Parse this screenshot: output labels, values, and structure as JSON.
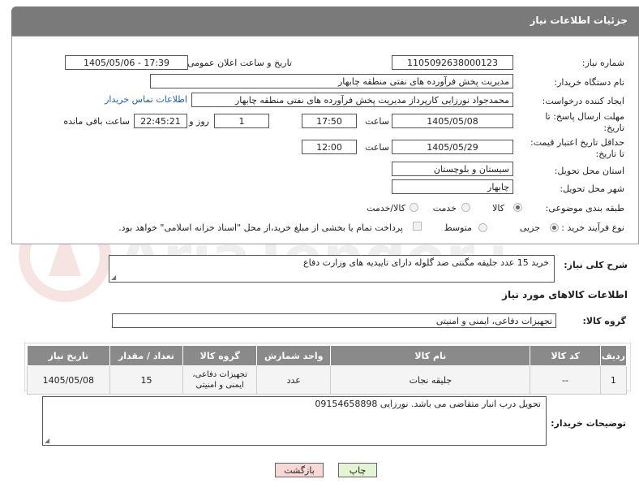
{
  "header": {
    "title": "جزئیات اطلاعات نیاز"
  },
  "form": {
    "need_number": {
      "label": "شماره نیاز:",
      "value": "1105092638000123"
    },
    "announce_datetime": {
      "label": "تاریخ و ساعت اعلان عمومی:",
      "value": "1405/05/06 - 17:39"
    },
    "buyer_org": {
      "label": "نام دستگاه خریدار:",
      "value": "مدیریت پخش فرآورده های نفتی منطقه چابهار"
    },
    "requester": {
      "label": "ایجاد کننده درخواست:",
      "value": "محمدجواد نورزایی کارپرداز مدیریت پخش فرآورده های نفتی منطقه چابهار",
      "contact_link": "اطلاعات تماس خریدار"
    },
    "reply_deadline": {
      "label_line1": "مهلت ارسال پاسخ: تا",
      "label_line2": "تاریخ:",
      "date": "1405/05/08",
      "time_label": "ساعت",
      "time": "17:50",
      "days": "1",
      "days_label": "روز و",
      "remaining": "22:45:21",
      "remaining_label": "ساعت باقی مانده"
    },
    "price_validity": {
      "label_line1": "حداقل تاریخ اعتبار قیمت:",
      "label_line2": "تا تاریخ:",
      "date": "1405/05/29",
      "time_label": "ساعت",
      "time": "12:00"
    },
    "province": {
      "label": "استان محل تحویل:",
      "value": "سیستان و بلوچستان"
    },
    "city": {
      "label": "شهر محل تحویل:",
      "value": "چابهار"
    },
    "category": {
      "label": "طبقه بندی موضوعی:",
      "options": [
        "کالا",
        "خدمت",
        "کالا/خدمت"
      ],
      "selected": "کالا"
    },
    "purchase_type": {
      "label": "نوع فرآیند خرید :",
      "options": [
        "جزیی",
        "متوسط"
      ],
      "selected": "جزیی",
      "payment_note": "پرداخت تمام یا بخشی از مبلغ خرید،از محل \"اسناد خزانه اسلامی\" خواهد بود."
    }
  },
  "summary": {
    "label": "شرح کلی نیاز:",
    "value": "خرید 15 عدد جلیقه مگنتی ضد گلوله دارای تاییدیه های وزارت دفاع"
  },
  "goods_info": {
    "title": "اطلاعات کالاهای مورد نیاز"
  },
  "goods_group": {
    "label": "گروه کالا:",
    "value": "تجهیزات دفاعی، ایمنی و امنیتی"
  },
  "table": {
    "headers": [
      "ردیف",
      "کد کالا",
      "نام کالا",
      "واحد شمارش",
      "گروه کالا",
      "تعداد / مقدار",
      "تاریخ نیاز"
    ],
    "rows": [
      {
        "row": "1",
        "code": "--",
        "name": "جلیقه نجات",
        "unit": "عدد",
        "group": "تجهیزات دفاعی، ایمنی و امنیتی",
        "qty": "15",
        "date": "1405/05/08"
      }
    ]
  },
  "buyer_notes": {
    "label": "توضیحات خریدار:",
    "value": "تحویل درب انبار متقاضی می باشد. نورزایی 09154658898"
  },
  "buttons": {
    "print": "چاپ",
    "back": "بازگشت"
  },
  "watermark": {
    "text": "AriaTender.neT"
  },
  "colors": {
    "header_bg": "#7a7a7a",
    "table_header_bg": "#8a8a8a",
    "link": "#1a5fb4",
    "back_button_bg": "#f8d7d7",
    "print_button_bg": "#e4f4d4"
  }
}
